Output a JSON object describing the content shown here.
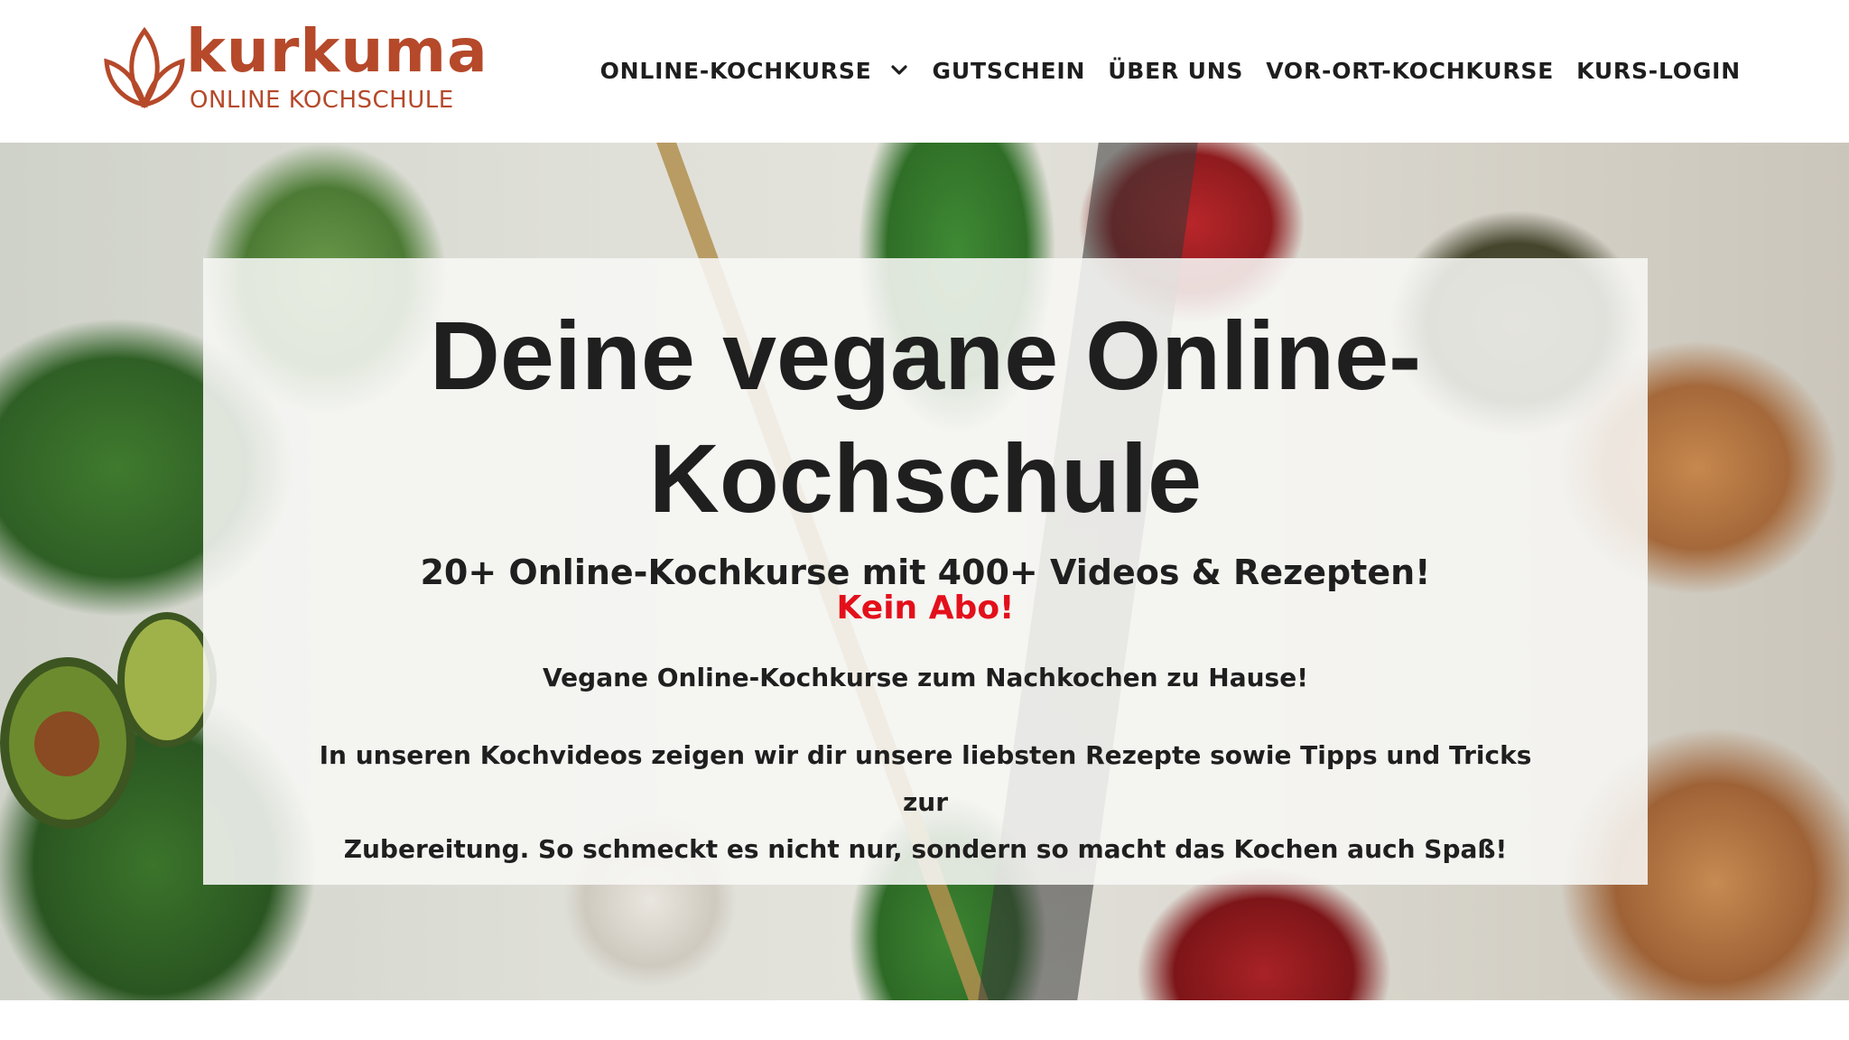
{
  "brand": {
    "name": "kurkuma",
    "tagline": "ONLINE  KOCHSCHULE",
    "color": "#b5492a"
  },
  "nav": {
    "items": [
      {
        "label": "ONLINE-KOCHKURSE",
        "has_dropdown": true
      },
      {
        "label": "GUTSCHEIN"
      },
      {
        "label": "ÜBER UNS"
      },
      {
        "label": "VOR-ORT-KOCHKURSE"
      },
      {
        "label": "KURS-LOGIN"
      }
    ]
  },
  "hero": {
    "title_line1": "Deine vegane Online-",
    "title_line2": "Kochschule",
    "subtitle": "20+ Online-Kochkurse mit 400+ Videos & Rezepten!",
    "highlight": "Kein Abo!",
    "highlight_color": "#e3101b",
    "tagline": "Vegane Online-Kochkurse zum Nachkochen zu Hause!",
    "description_line1": "In unseren Kochvideos zeigen wir dir unsere liebsten Rezepte sowie Tipps und Tricks zur",
    "description_line2": "Zubereitung. So schmeckt es nicht nur, sondern so macht das Kochen auch Spaß!"
  }
}
